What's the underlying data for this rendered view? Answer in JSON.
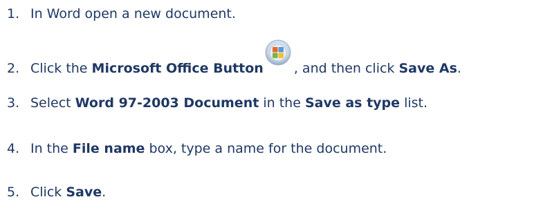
{
  "steps": [
    {
      "number": "1.",
      "text": "In Word open a new document."
    },
    {
      "number": "2.",
      "pre": "Click the ",
      "bold1": "Microsoft Office Button",
      "mid": ", and then click ",
      "bold2": "Save As",
      "post": "."
    },
    {
      "number": "3.",
      "pre": "Select ",
      "bold1": "Word 97-2003 Document",
      "mid": " in the ",
      "bold2": "Save as type",
      "post": " list."
    },
    {
      "number": "4.",
      "pre": "In the ",
      "bold1": "File name",
      "post": " box, type a name for the document."
    },
    {
      "number": "5.",
      "pre": "Click ",
      "bold1": "Save",
      "post": "."
    }
  ],
  "icons": {
    "office_button": "microsoft-office-button-icon"
  },
  "colors": {
    "text": "#1f3864"
  }
}
